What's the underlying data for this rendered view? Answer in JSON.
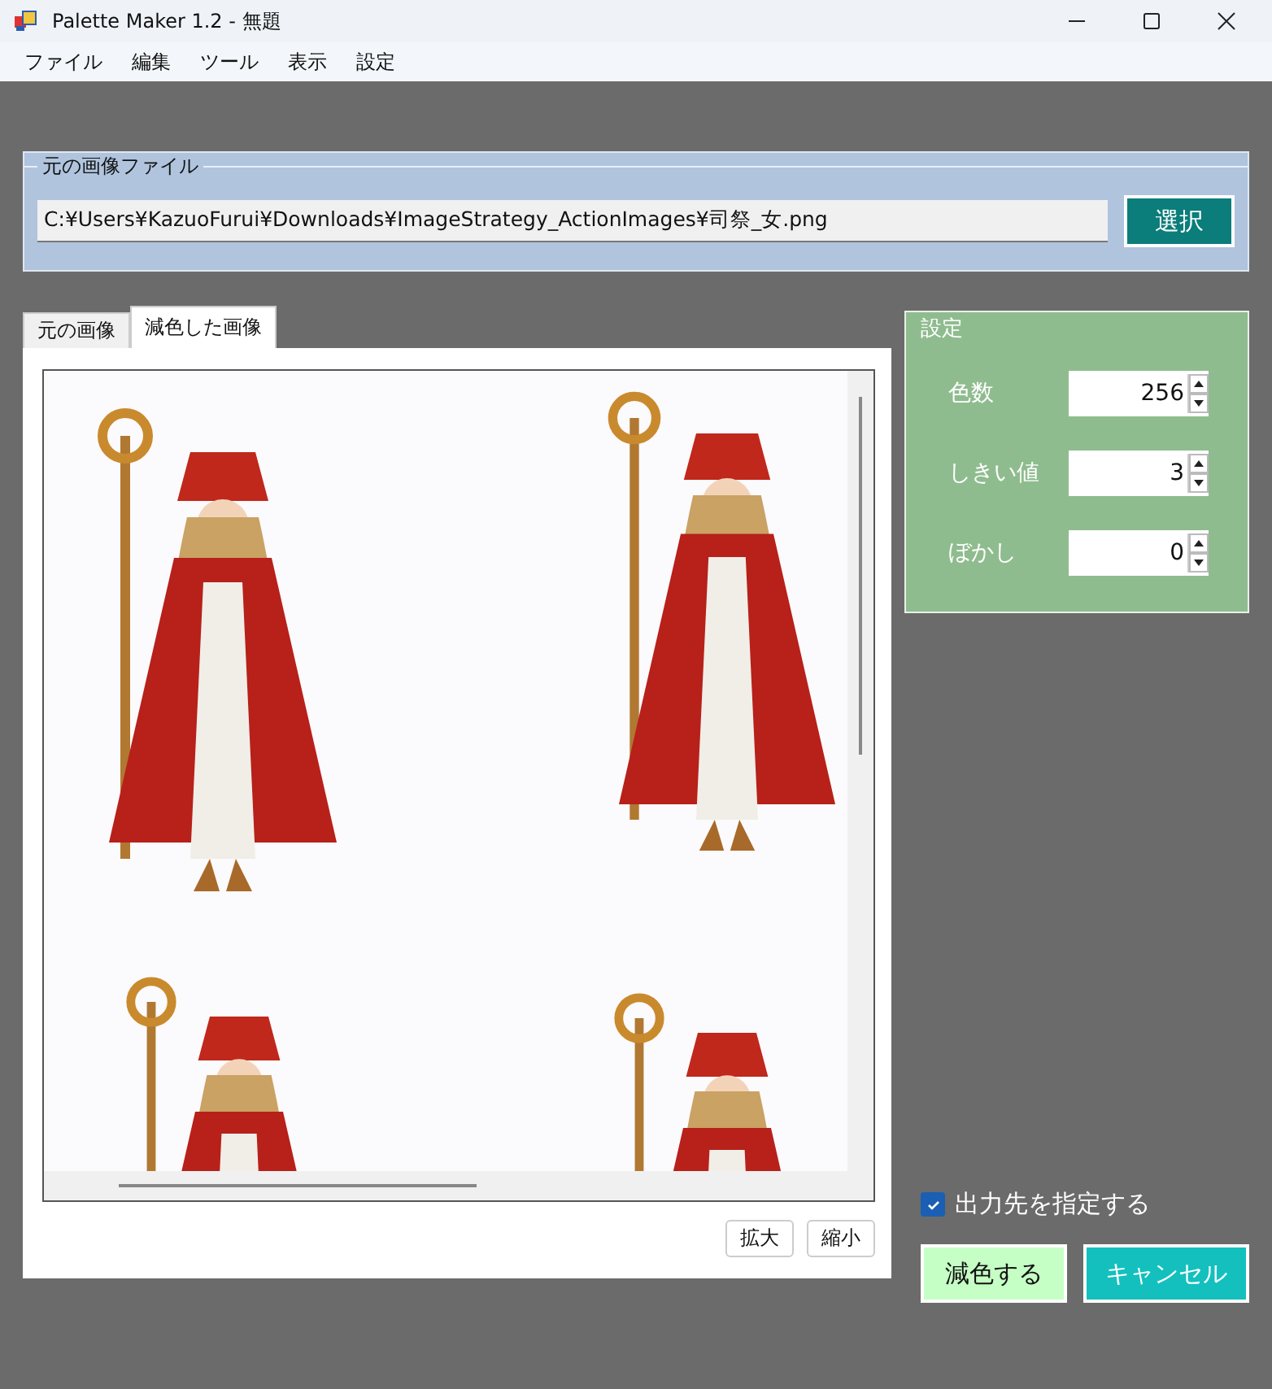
{
  "window": {
    "title": "Palette Maker 1.2 - 無題"
  },
  "menu": [
    "ファイル",
    "編集",
    "ツール",
    "表示",
    "設定"
  ],
  "source_file": {
    "title": "元の画像ファイル",
    "path": "C:¥Users¥KazuoFurui¥Downloads¥ImageStrategy_ActionImages¥司祭_女.png",
    "button": "選択"
  },
  "tabs": [
    {
      "label": "元の画像",
      "selected": false
    },
    {
      "label": "減色した画像",
      "selected": true
    }
  ],
  "preview": {
    "kind": "picture",
    "buttons": [
      "拡大",
      "縮小"
    ]
  },
  "settings": {
    "title": "設定",
    "fields": [
      {
        "label": "色数",
        "value": "256"
      },
      {
        "label": "しきい値",
        "value": "3"
      },
      {
        "label": "ぼかし",
        "value": "0"
      }
    ]
  },
  "output_option": {
    "label": "出力先を指定する",
    "checked": true
  },
  "actions": [
    {
      "label": "減色する",
      "kind": "primary"
    },
    {
      "label": "キャンセル",
      "kind": "cancel"
    }
  ]
}
